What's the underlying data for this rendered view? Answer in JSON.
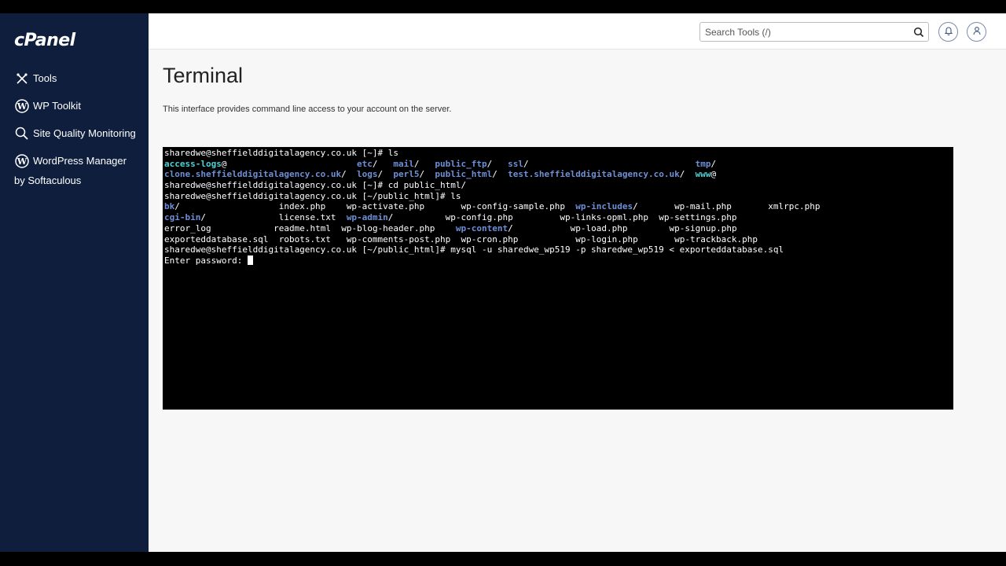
{
  "sidebar": {
    "logo": "cPanel",
    "items": [
      {
        "label": "Tools",
        "icon": "tools-icon"
      },
      {
        "label": "WP Toolkit",
        "icon": "wordpress-icon"
      },
      {
        "label": "Site Quality Monitoring",
        "icon": "magnifier-icon"
      },
      {
        "label": "WordPress Manager",
        "icon": "wordpress-icon"
      }
    ],
    "wp_manager_sub": "by Softaculous"
  },
  "topbar": {
    "search_placeholder": "Search Tools (/)",
    "icons": [
      "search-icon",
      "bell-icon",
      "user-icon"
    ]
  },
  "page": {
    "title": "Terminal",
    "description": "This interface provides command line access to your account on the server."
  },
  "terminal": {
    "prompt_home": "sharedwe@sheffielddigitalagency.co.uk [~]#",
    "prompt_public": "sharedwe@sheffielddigitalagency.co.uk [~/public_html]#",
    "cmd1": "ls",
    "cmd2": "cd public_html/",
    "cmd3": "ls",
    "cmd4": "mysql -u sharedwe_wp519 -p sharedwe_wp519 < exporteddatabase.sql",
    "password_prompt": "Enter password:",
    "home_ls": {
      "access_logs": "access-logs",
      "etc": "etc",
      "mail": "mail",
      "public_ftp": "public_ftp",
      "ssl": "ssl",
      "tmp": "tmp",
      "clone": "clone.sheffielddigitalagency.co.uk",
      "logs": "logs",
      "perl5": "perl5",
      "public_html": "public_html",
      "test": "test.sheffielddigitalagency.co.uk",
      "www": "www"
    },
    "public_ls": {
      "bk": "bk",
      "index": "index.php",
      "wp_activate": "wp-activate.php",
      "wp_config_sample": "wp-config-sample.php",
      "wp_includes": "wp-includes",
      "wp_mail": "wp-mail.php",
      "xmlrpc": "xmlrpc.php",
      "cgi_bin": "cgi-bin",
      "license": "license.txt",
      "wp_admin": "wp-admin",
      "wp_config": "wp-config.php",
      "wp_links_opml": "wp-links-opml.php",
      "wp_settings": "wp-settings.php",
      "error_log": "error_log",
      "readme": "readme.html",
      "wp_blog_header": "wp-blog-header.php",
      "wp_content": "wp-content",
      "wp_load": "wp-load.php",
      "wp_signup": "wp-signup.php",
      "exporteddatabase": "exporteddatabase.sql",
      "robots": "robots.txt",
      "wp_comments_post": "wp-comments-post.php",
      "wp_cron": "wp-cron.php",
      "wp_login": "wp-login.php",
      "wp_trackback": "wp-trackback.php"
    }
  },
  "colors": {
    "sidebar_bg": "#0e1e3c",
    "main_bg": "#f7f7f7",
    "terminal_bg": "#000000",
    "dir_color": "#6e8fd6",
    "link_color": "#4fd1d6"
  }
}
